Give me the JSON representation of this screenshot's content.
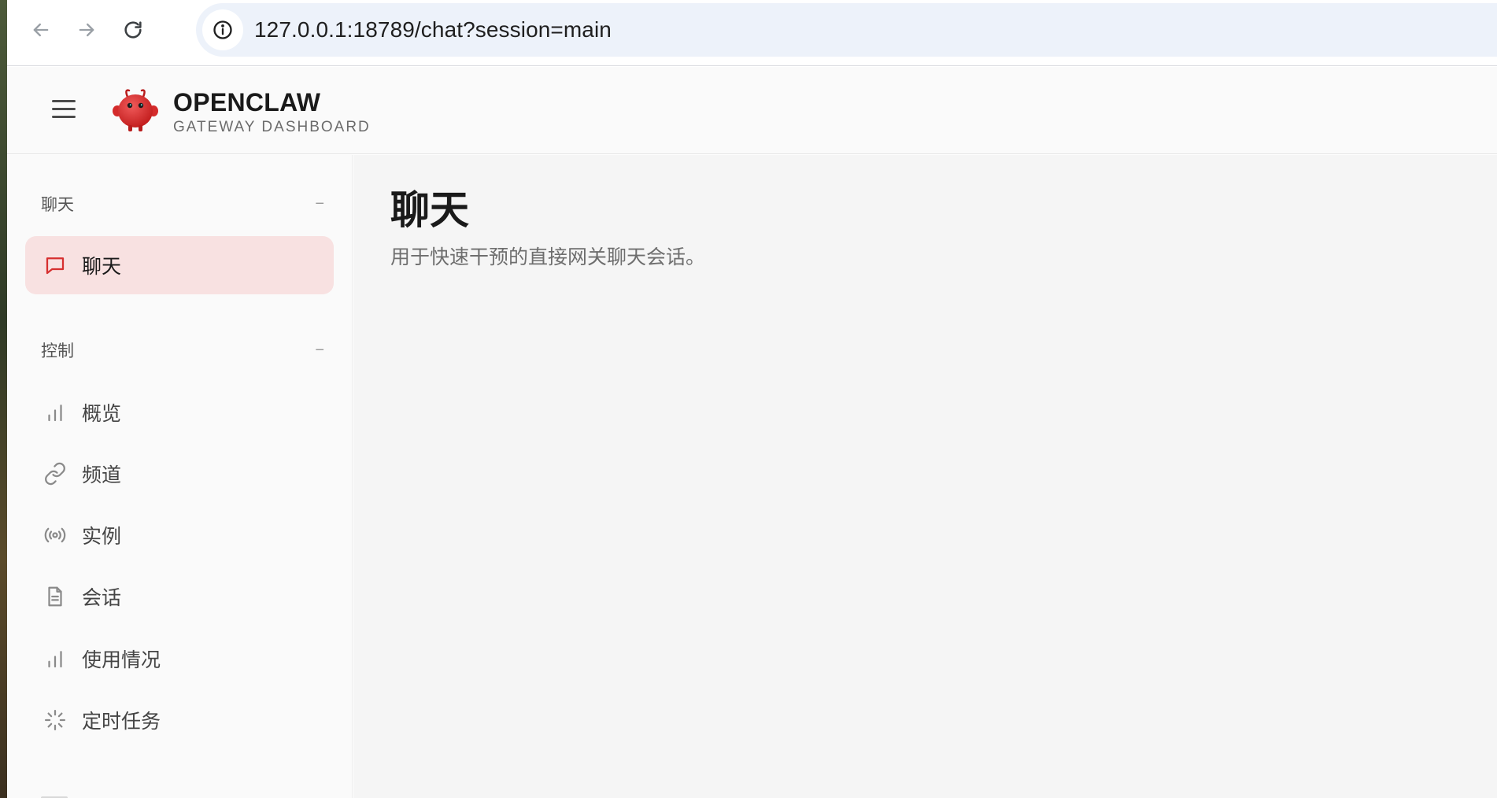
{
  "browser": {
    "url": "127.0.0.1:18789/chat?session=main"
  },
  "app": {
    "brand_title": "OPENCLAW",
    "brand_subtitle": "GATEWAY DASHBOARD",
    "accent_color": "#d62f2f"
  },
  "sidebar": {
    "groups": [
      {
        "label": "聊天",
        "collapse_glyph": "−",
        "items": [
          {
            "label": "聊天",
            "icon": "chat-bubble-icon",
            "active": true
          }
        ]
      },
      {
        "label": "控制",
        "collapse_glyph": "−",
        "items": [
          {
            "label": "概览",
            "icon": "bar-chart-icon"
          },
          {
            "label": "频道",
            "icon": "link-icon"
          },
          {
            "label": "实例",
            "icon": "broadcast-icon"
          },
          {
            "label": "会话",
            "icon": "document-icon"
          },
          {
            "label": "使用情况",
            "icon": "bar-chart-icon"
          },
          {
            "label": "定时任务",
            "icon": "loader-icon"
          }
        ]
      }
    ]
  },
  "main": {
    "title": "聊天",
    "subtitle": "用于快速干预的直接网关聊天会话。"
  }
}
